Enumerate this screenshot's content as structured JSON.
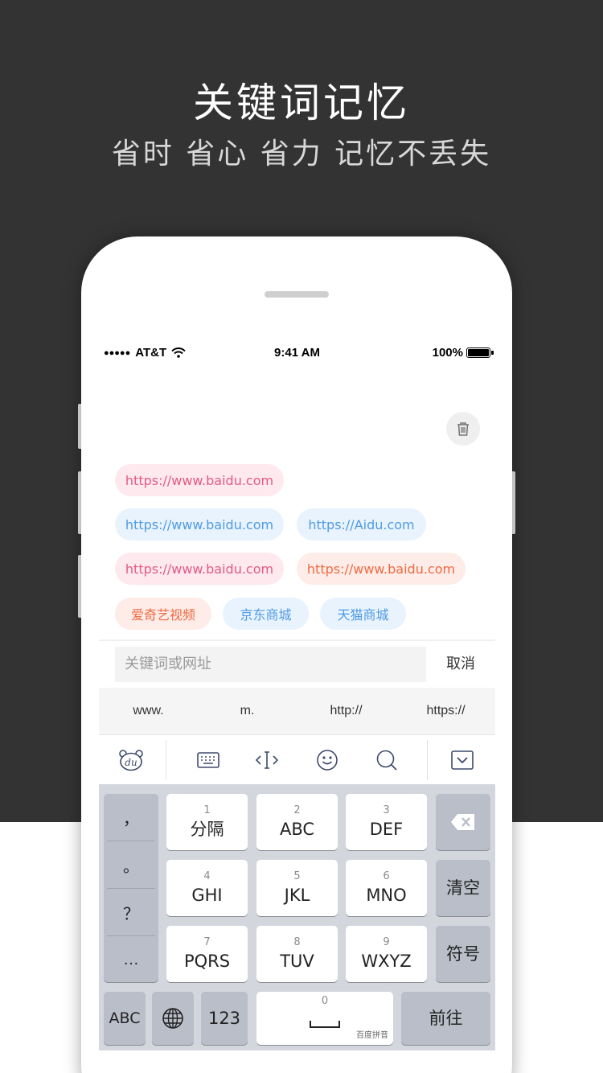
{
  "hero": {
    "title": "关键词记忆",
    "subtitle": "省时 省心 省力 记忆不丢失"
  },
  "status_bar": {
    "carrier": "AT&T",
    "time": "9:41 AM",
    "battery": "100%",
    "signal_dots": "●●●●●"
  },
  "icons": {
    "trash": "trash-icon",
    "du_logo": "du-logo-icon",
    "keyboard": "keyboard-icon",
    "cursor": "cursor-move-icon",
    "emoji": "emoji-icon",
    "search": "search-icon",
    "collapse": "chevron-down-icon",
    "backspace": "backspace-icon",
    "globe": "globe-icon"
  },
  "history_chips": [
    {
      "label": "https://www.baidu.com",
      "style": "pink"
    },
    {
      "label": "https://www.baidu.com",
      "style": "blue"
    },
    {
      "label": "https://Aidu.com",
      "style": "blue"
    },
    {
      "label": "https://www.baidu.com",
      "style": "pink"
    },
    {
      "label": "https://www.baidu.com",
      "style": "orange"
    },
    {
      "label": "爱奇艺视频",
      "style": "orange"
    },
    {
      "label": "京东商城",
      "style": "blue"
    },
    {
      "label": "天猫商城",
      "style": "blue"
    }
  ],
  "search": {
    "placeholder": "关键词或网址",
    "cancel_label": "取消"
  },
  "suggestions": [
    "www.",
    "m.",
    "http://",
    "https://"
  ],
  "keyboard": {
    "punctuation": [
      "，",
      "。",
      "？",
      "…"
    ],
    "keys": [
      {
        "num": "1",
        "label": "分隔"
      },
      {
        "num": "2",
        "label": "ABC"
      },
      {
        "num": "3",
        "label": "DEF"
      },
      {
        "num": "4",
        "label": "GHI"
      },
      {
        "num": "5",
        "label": "JKL"
      },
      {
        "num": "6",
        "label": "MNO"
      },
      {
        "num": "7",
        "label": "PQRS"
      },
      {
        "num": "8",
        "label": "TUV"
      },
      {
        "num": "9",
        "label": "WXYZ"
      }
    ],
    "clear_label": "清空",
    "symbol_label": "符号",
    "abc_label": "ABC",
    "num_label": "123",
    "space_num": "0",
    "space_brand": "百度拼音",
    "go_label": "前往"
  }
}
